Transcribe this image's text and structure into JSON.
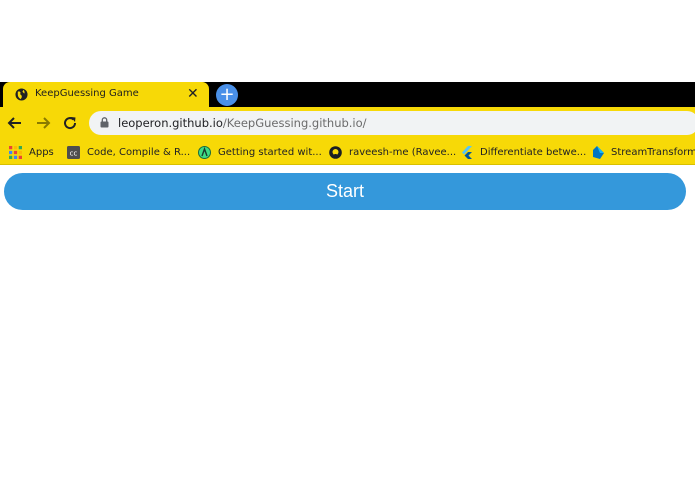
{
  "tab": {
    "title": "KeepGuessing Game",
    "close": "✕",
    "new_tab": "+"
  },
  "address_bar": {
    "host": "leoperon.github.io",
    "path": "/KeepGuessing.github.io/"
  },
  "bookmarks": [
    {
      "label": "Apps",
      "icon": "apps-grid-icon"
    },
    {
      "label": "Code, Compile & R...",
      "icon": "codechef-icon"
    },
    {
      "label": "Getting started wit...",
      "icon": "android-studio-icon"
    },
    {
      "label": "raveesh-me (Ravee...",
      "icon": "github-icon"
    },
    {
      "label": "Differentiate betwe...",
      "icon": "flutter-icon"
    },
    {
      "label": "StreamTransformer",
      "icon": "dart-icon"
    }
  ],
  "main": {
    "start_label": "Start"
  },
  "colors": {
    "chrome_yellow": "#f7d907",
    "button_blue": "#3498db",
    "newtab_blue": "#4a90e8"
  }
}
